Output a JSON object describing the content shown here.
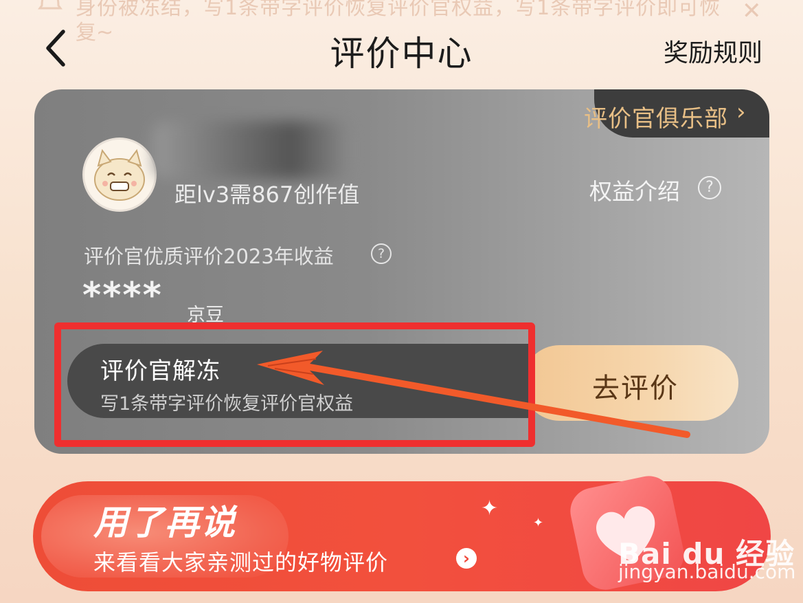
{
  "notice": {
    "line1": "身份被冻结，写1条带字评价恢复评价官权益，写1条带字评价即可恢",
    "line2": "复~",
    "close_icon": "close-icon"
  },
  "header": {
    "back_icon": "back-arrow-icon",
    "title": "评价中心",
    "rules": "奖励规则"
  },
  "card": {
    "club_label": "评价官俱乐部",
    "club_chevron": "›",
    "level_hint": "距lv3需867创作值",
    "rights_label": "权益介绍",
    "help_glyph": "?",
    "income_label": "评价官优质评价2023年收益",
    "income_masked": "****",
    "income_unit": "京豆",
    "frozen": {
      "title": "评价官解冻",
      "subtitle": "写1条带字评价恢复评价官权益"
    },
    "go_review": "去评价"
  },
  "promo": {
    "title": "用了再说",
    "subtitle": "来看看大家亲测过的好物评价",
    "arrow": "›"
  },
  "watermark": {
    "brand": "Bai du 经验",
    "url": "jingyan.baidu.com"
  },
  "colors": {
    "highlight": "#ef2f2f",
    "annotation_arrow": "#f25a2a",
    "club_text": "#e8bf86",
    "promo_bg": "#f04a3c"
  }
}
